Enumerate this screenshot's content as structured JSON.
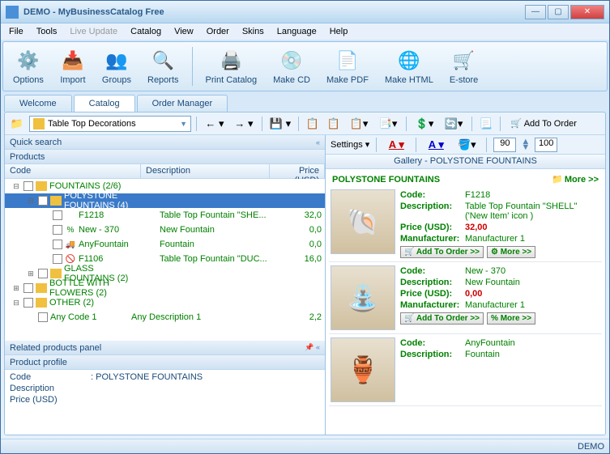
{
  "title": "DEMO - MyBusinessCatalog Free",
  "menu": [
    "File",
    "Tools",
    "Live Update",
    "Catalog",
    "View",
    "Order",
    "Skins",
    "Language",
    "Help"
  ],
  "menu_disabled": [
    2
  ],
  "toolbar": [
    {
      "label": "Options",
      "icon": "⚙️"
    },
    {
      "label": "Import",
      "icon": "📥"
    },
    {
      "label": "Groups",
      "icon": "👥"
    },
    {
      "label": "Reports",
      "icon": "🔍"
    },
    {
      "label": "Print Catalog",
      "icon": "🖨️"
    },
    {
      "label": "Make CD",
      "icon": "💿"
    },
    {
      "label": "Make PDF",
      "icon": "📄"
    },
    {
      "label": "Make HTML",
      "icon": "🌐"
    },
    {
      "label": "E-store",
      "icon": "🛒"
    }
  ],
  "tabs": [
    "Welcome",
    "Catalog",
    "Order Manager"
  ],
  "activeTab": 1,
  "combo": "Table Top Decorations",
  "addToOrder": "Add To Order",
  "quickSearch": "Quick search",
  "productsLabel": "Products",
  "cols": {
    "code": "Code",
    "desc": "Description",
    "price": "Price (USD)"
  },
  "tree": [
    {
      "lvl": 0,
      "exp": "⊟",
      "fold": true,
      "code": "FOUNTAINS   (2/6)",
      "desc": "",
      "price": ""
    },
    {
      "lvl": 1,
      "exp": "⊟",
      "fold": true,
      "sel": true,
      "code": "POLYSTONE FOUNTAINS   (4)",
      "desc": "",
      "price": ""
    },
    {
      "lvl": 2,
      "exp": "",
      "ic": "",
      "code": "F1218",
      "desc": "Table Top Fountain \"SHE...",
      "price": "32,0"
    },
    {
      "lvl": 2,
      "exp": "",
      "ic": "%",
      "code": "New - 370",
      "desc": "New Fountain",
      "price": "0,0"
    },
    {
      "lvl": 2,
      "exp": "",
      "ic": "🚚",
      "code": "AnyFountain",
      "desc": "Fountain",
      "price": "0,0"
    },
    {
      "lvl": 2,
      "exp": "",
      "ic": "🚫",
      "code": "F1106",
      "desc": "Table Top Fountain \"DUC...",
      "price": "16,0"
    },
    {
      "lvl": 1,
      "exp": "⊞",
      "fold": true,
      "code": "GLASS FOUNTAINS   (2)",
      "desc": "",
      "price": ""
    },
    {
      "lvl": 0,
      "exp": "⊞",
      "fold": true,
      "code": "BOTTLE WITH FLOWERS   (2)",
      "desc": "",
      "price": ""
    },
    {
      "lvl": 0,
      "exp": "⊟",
      "fold": true,
      "code": "OTHER   (2)",
      "desc": "",
      "price": ""
    },
    {
      "lvl": 1,
      "exp": "",
      "code": "Any Code 1",
      "desc": "Any Description 1",
      "price": "2,2"
    }
  ],
  "related": "Related products panel",
  "profileTitle": "Product profile",
  "profile": [
    {
      "lab": "Code",
      "val": ": POLYSTONE FOUNTAINS"
    },
    {
      "lab": "Description",
      "val": ""
    },
    {
      "lab": "Price (USD)",
      "val": ""
    }
  ],
  "right": {
    "settings": "Settings",
    "num1": "90",
    "num2": "100",
    "galHdr": "Gallery - POLYSTONE FOUNTAINS",
    "galTitle": "POLYSTONE FOUNTAINS",
    "more": "More >>",
    "addOrder": "Add To Order >>",
    "cards": [
      {
        "code": "F1218",
        "desc": "Table Top Fountain \"SHELL\"    ('New Item' icon )",
        "price": "32,00",
        "mfr": "Manufacturer 1",
        "thumb": "🐚"
      },
      {
        "code": "New - 370",
        "desc": "New Fountain",
        "price": "0,00",
        "mfr": "Manufacturer 1",
        "thumb": "⛲"
      },
      {
        "code": "AnyFountain",
        "desc": "Fountain",
        "price": "",
        "mfr": "",
        "thumb": "🏺"
      }
    ],
    "labs": {
      "code": "Code:",
      "desc": "Description:",
      "price": "Price (USD):",
      "mfr": "Manufacturer:"
    }
  },
  "status": "DEMO"
}
